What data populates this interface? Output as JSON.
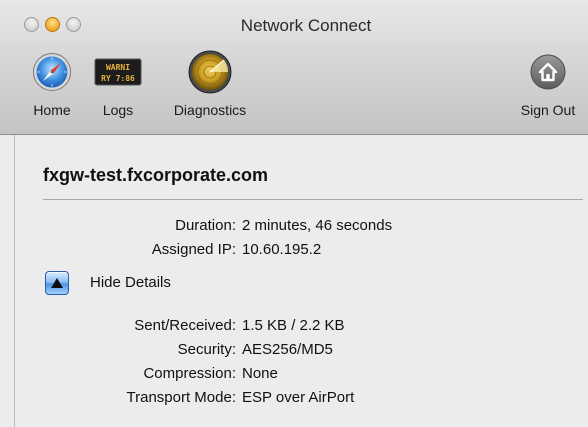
{
  "window": {
    "title": "Network Connect"
  },
  "toolbar": {
    "items": [
      {
        "label": "Home",
        "icon": "compass-icon"
      },
      {
        "label": "Logs",
        "icon": "log-display-icon",
        "display_line1": "WARNI",
        "display_line2": "RY 7:86"
      },
      {
        "label": "Diagnostics",
        "icon": "radar-icon"
      },
      {
        "label": "Sign Out",
        "icon": "home-signout-icon"
      }
    ]
  },
  "connection": {
    "host": "fxgw-test.fxcorporate.com",
    "summary": [
      {
        "label": "Duration:",
        "value": "2 minutes, 46 seconds"
      },
      {
        "label": "Assigned IP:",
        "value": "10.60.195.2"
      }
    ],
    "details_toggle_label": "Hide Details",
    "details": [
      {
        "label": "Sent/Received:",
        "value": "1.5 KB / 2.2 KB"
      },
      {
        "label": "Security:",
        "value": "AES256/MD5"
      },
      {
        "label": "Compression:",
        "value": "None"
      },
      {
        "label": "Transport Mode:",
        "value": "ESP over AirPort"
      }
    ]
  },
  "colors": {
    "accent_blue": "#4f95e6",
    "minimize_yellow": "#f0a724",
    "radar_gold": "#c99a1e"
  }
}
